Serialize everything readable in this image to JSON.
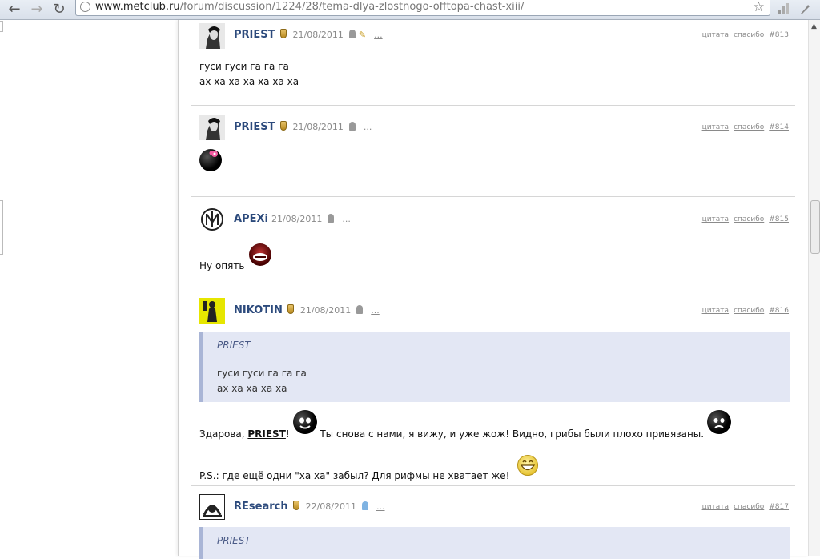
{
  "browser": {
    "url_host": "www.metclub.ru",
    "url_path": "/forum/discussion/1224/28/tema-dlya-zlostnogo-offtopa-chast-xiii/"
  },
  "actions": {
    "quote": "цитата",
    "thanks": "спасибо"
  },
  "posts": [
    {
      "author": "PRIEST",
      "date": "21/08/2011",
      "more": "...",
      "num": "#813",
      "lines": [
        "гуси гуси га га га",
        "ах ха ха ха ха ха ха"
      ]
    },
    {
      "author": "PRIEST",
      "date": "21/08/2011",
      "more": "...",
      "num": "#814"
    },
    {
      "author": "APEXi",
      "date": "21/08/2011",
      "more": "...",
      "num": "#815",
      "text": "Ну опять"
    },
    {
      "author": "NIKOTIN",
      "date": "21/08/2011",
      "more": "...",
      "num": "#816",
      "quote": {
        "author": "PRIEST",
        "lines": [
          "гуси гуси га га га",
          "ах ха ха ха ха"
        ]
      },
      "line1_a": "Здарова, ",
      "line1_name": "PRIEST",
      "line1_b": "!",
      "line1_c": " Ты снова с нами, я вижу, и уже жож! Видно, грибы были плохо привязаны.",
      "line2": "P.S.: где ещё одни \"ха ха\" забыл? Для рифмы не хватает же!"
    },
    {
      "author": "REsearch",
      "date": "22/08/2011",
      "more": "...",
      "num": "#817",
      "quote": {
        "author": "PRIEST"
      }
    }
  ],
  "colors": {
    "author": "#2c4a7c",
    "quote_bg": "#e3e7f4"
  }
}
